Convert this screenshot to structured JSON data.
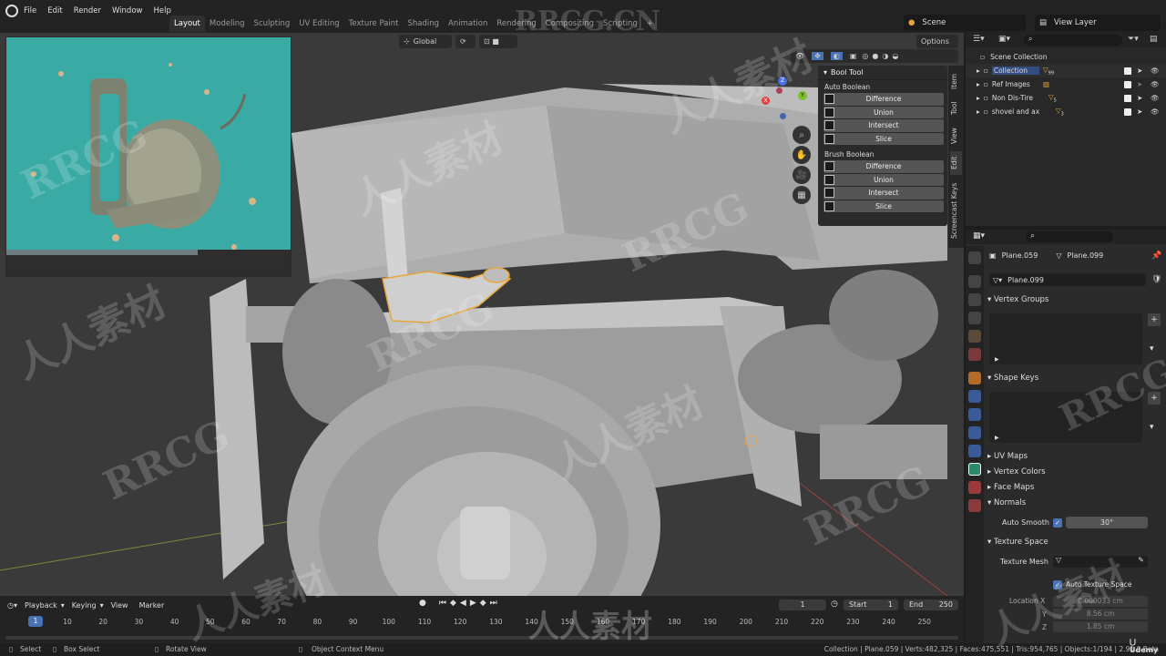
{
  "app": {
    "name": "Blender",
    "version": "2.91.0 Beta"
  },
  "menu": [
    "File",
    "Edit",
    "Render",
    "Window",
    "Help"
  ],
  "workspaces": [
    "Layout",
    "Modeling",
    "Sculpting",
    "UV Editing",
    "Texture Paint",
    "Shading",
    "Animation",
    "Rendering",
    "Compositing",
    "Scripting"
  ],
  "active_workspace": "Layout",
  "header": {
    "scene": "Scene",
    "view_layer": "View Layer"
  },
  "viewport": {
    "orientation": "Global",
    "options_label": "Options",
    "gizmo": {
      "x": "X",
      "y": "Y",
      "z": "Z"
    },
    "colors": {
      "background": "#3a3a3a",
      "selection": "#e8a53a"
    }
  },
  "bool_tool": {
    "title": "Bool Tool",
    "auto_boolean": {
      "title": "Auto Boolean",
      "buttons": [
        "Difference",
        "Union",
        "Intersect",
        "Slice"
      ]
    },
    "brush_boolean": {
      "title": "Brush Boolean",
      "buttons": [
        "Difference",
        "Union",
        "Intersect",
        "Slice"
      ]
    }
  },
  "sidebar_tabs": [
    "Item",
    "Tool",
    "View",
    "Edit",
    "Screencast Keys"
  ],
  "outliner": {
    "root": "Scene Collection",
    "items": [
      {
        "name": "Collection",
        "count": "99"
      },
      {
        "name": "Ref Images",
        "count": ""
      },
      {
        "name": "Non Dis-Tire",
        "count": "5"
      },
      {
        "name": "shovel and ax",
        "count": "3"
      }
    ]
  },
  "properties": {
    "object_name": "Plane.059",
    "mesh_name": "Plane.099",
    "datablock": "Plane.099",
    "sections": {
      "vertex_groups": "Vertex Groups",
      "shape_keys": "Shape Keys",
      "uv_maps": "UV Maps",
      "vertex_colors": "Vertex Colors",
      "face_maps": "Face Maps",
      "normals": "Normals",
      "texture_space": "Texture Space"
    },
    "auto_smooth_label": "Auto Smooth",
    "auto_smooth_angle": "30°",
    "texture_mesh_label": "Texture Mesh",
    "auto_texture_space": "Auto Texture Space",
    "location_label": "Location X",
    "location": {
      "x": "0.000033 cm",
      "y": "8.56 cm",
      "z": "1.85 cm"
    },
    "axis_y": "Y",
    "axis_z": "Z"
  },
  "timeline": {
    "menus": [
      "Playback",
      "Keying",
      "View",
      "Marker"
    ],
    "current_frame": "1",
    "current": "1",
    "start_label": "Start",
    "start": "1",
    "end_label": "End",
    "end": "250",
    "ticks": [
      "10",
      "20",
      "30",
      "40",
      "50",
      "60",
      "70",
      "80",
      "90",
      "100",
      "110",
      "120",
      "130",
      "140",
      "150",
      "160",
      "170",
      "180",
      "190",
      "200",
      "210",
      "220",
      "230",
      "240",
      "250"
    ]
  },
  "statusbar": {
    "select": "Select",
    "box_select": "Box Select",
    "rotate": "Rotate View",
    "context_menu": "Object Context Menu",
    "stats": "Collection | Plane.059 | Verts:482,325 | Faces:475,551 | Tris:954,765 | Objects:1/194 | 2.91.0 Beta"
  },
  "watermarks": {
    "site": "RRCG.CN",
    "brand": "RRCG",
    "cn": "人人素材",
    "udemy": "Udemy"
  }
}
